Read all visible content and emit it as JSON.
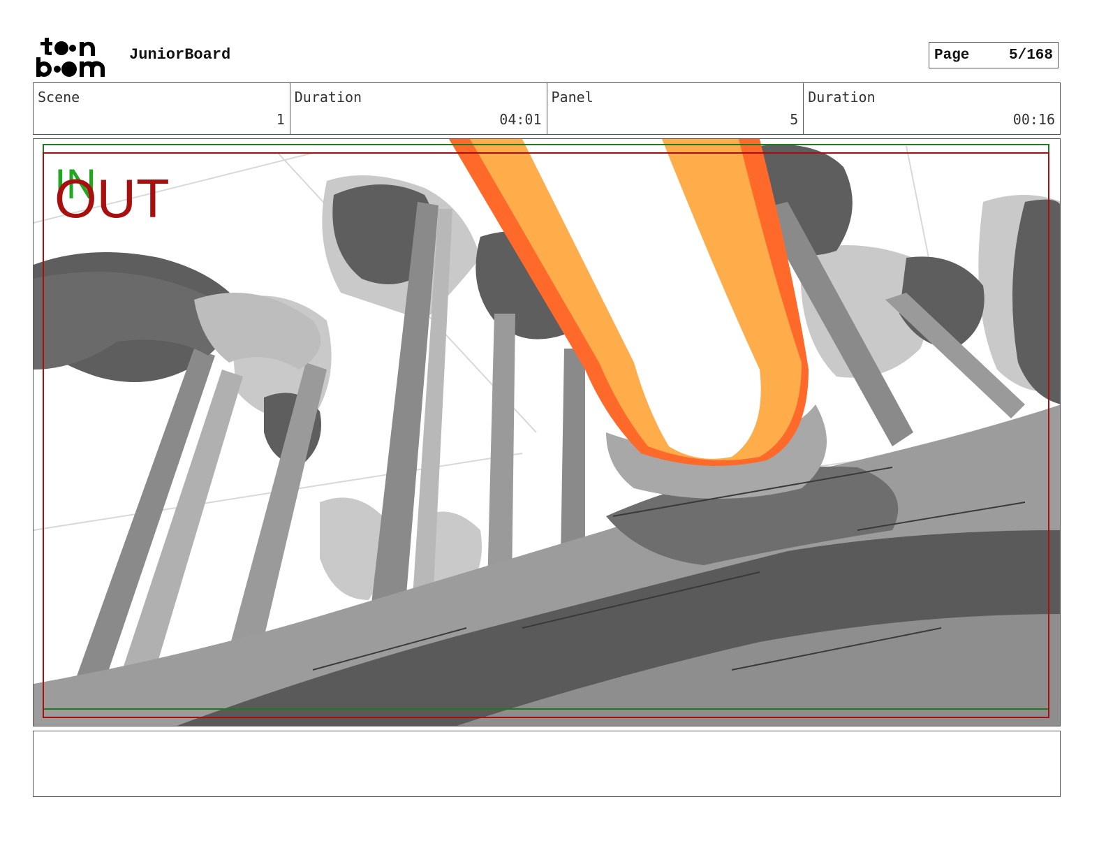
{
  "header": {
    "logo_text": "toon boom",
    "app_title": "JuniorBoard",
    "page_label": "Page",
    "page_value": "5/168"
  },
  "info": {
    "scene_label": "Scene",
    "scene_value": "1",
    "scene_duration_label": "Duration",
    "scene_duration_value": "04:01",
    "panel_label": "Panel",
    "panel_value": "5",
    "panel_duration_label": "Duration",
    "panel_duration_value": "00:16"
  },
  "panel": {
    "in_label": "IN",
    "out_label": "OUT"
  },
  "notes": {
    "text": ""
  },
  "colors": {
    "in_marker": "#1fa81f",
    "out_marker": "#a80f0f",
    "beam_outer": "#ff6a2b",
    "beam_mid": "#ffad4a"
  }
}
